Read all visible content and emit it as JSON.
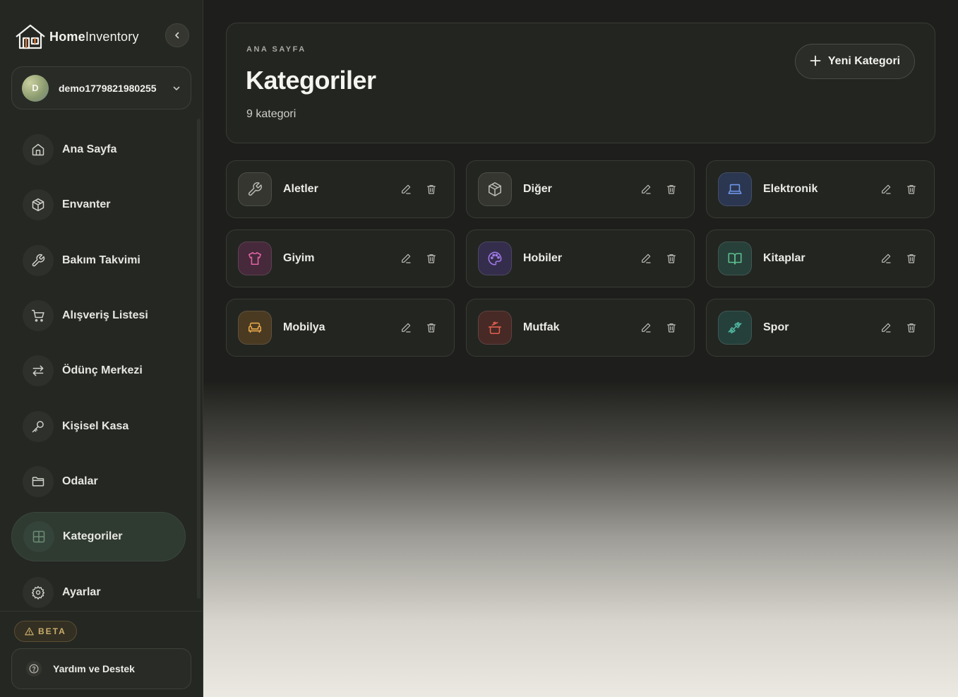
{
  "app": {
    "brand_bold": "Home",
    "brand_rest": "Inventory"
  },
  "user": {
    "initial": "D",
    "name": "demo1779821980255"
  },
  "sidebar": {
    "items": [
      {
        "label": "Ana Sayfa",
        "icon": "home-icon",
        "active": false
      },
      {
        "label": "Envanter",
        "icon": "box-icon",
        "active": false
      },
      {
        "label": "Bakım Takvimi",
        "icon": "wrench-icon",
        "active": false
      },
      {
        "label": "Alışveriş Listesi",
        "icon": "cart-icon",
        "active": false
      },
      {
        "label": "Ödünç Merkezi",
        "icon": "swap-icon",
        "active": false
      },
      {
        "label": "Kişisel Kasa",
        "icon": "key-icon",
        "active": false
      },
      {
        "label": "Odalar",
        "icon": "folder-icon",
        "active": false
      },
      {
        "label": "Kategoriler",
        "icon": "grid-icon",
        "active": true
      },
      {
        "label": "Ayarlar",
        "icon": "gear-icon",
        "active": false
      }
    ],
    "beta_label": "BETA",
    "help_label": "Yardım ve Destek"
  },
  "header": {
    "eyebrow": "ANA SAYFA",
    "title": "Kategoriler",
    "subtitle": "9 kategori",
    "new_button_label": "Yeni Kategori"
  },
  "categories": [
    {
      "label": "Aletler",
      "icon": "wrench-icon",
      "color": "#b8b8b2",
      "bg": "#34362f"
    },
    {
      "label": "Diğer",
      "icon": "box-icon",
      "color": "#b8b8b2",
      "bg": "#34362f"
    },
    {
      "label": "Elektronik",
      "icon": "laptop-icon",
      "color": "#6f95ea",
      "bg": "#2b3650"
    },
    {
      "label": "Giyim",
      "icon": "shirt-icon",
      "color": "#e064a4",
      "bg": "#46293a"
    },
    {
      "label": "Hobiler",
      "icon": "palette-icon",
      "color": "#a07ae8",
      "bg": "#352d4c"
    },
    {
      "label": "Kitaplar",
      "icon": "book-icon",
      "color": "#5fbf8e",
      "bg": "#27403a"
    },
    {
      "label": "Mobilya",
      "icon": "sofa-icon",
      "color": "#e8a94a",
      "bg": "#4a3a22"
    },
    {
      "label": "Mutfak",
      "icon": "cooking-pot-icon",
      "color": "#e0604e",
      "bg": "#472925"
    },
    {
      "label": "Spor",
      "icon": "dumbbell-icon",
      "color": "#4fb6a0",
      "bg": "#25403b"
    }
  ]
}
